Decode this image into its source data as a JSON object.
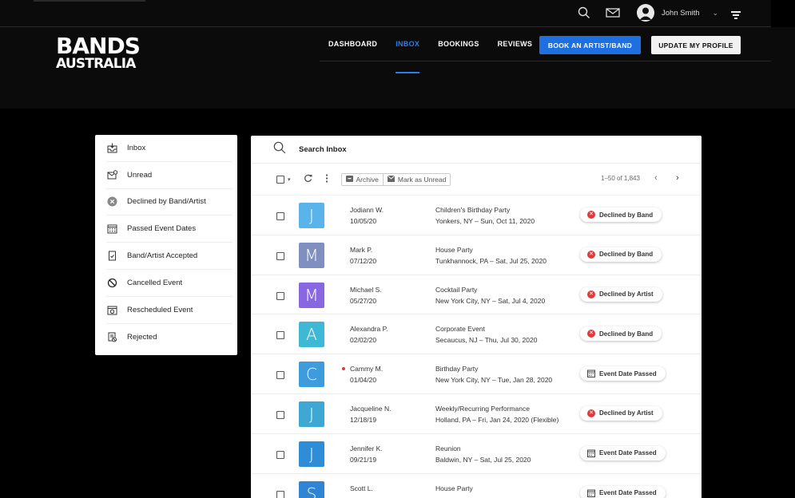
{
  "topbar": {
    "user_name": "John Smith",
    "icons": [
      "search-icon",
      "mail-icon",
      "user-avatar-icon",
      "chevron-down-icon",
      "menu-icon"
    ]
  },
  "header": {
    "logo_line1": "BANDS",
    "logo_line2": "AUSTRALIA",
    "nav": [
      {
        "label": "DASHBOARD",
        "active": false
      },
      {
        "label": "INBOX",
        "active": true
      },
      {
        "label": "BOOKINGS",
        "active": false
      },
      {
        "label": "REVIEWS",
        "active": false
      }
    ],
    "book_label": "BOOK AN ARTIST/BAND",
    "profile_label": "UPDATE MY PROFILE"
  },
  "sidebar": {
    "items": [
      {
        "label": "Inbox",
        "icon": "inbox-icon"
      },
      {
        "label": "Unread",
        "icon": "unread-mail-icon"
      },
      {
        "label": "Declined by Band/Artist",
        "icon": "declined-circle-icon"
      },
      {
        "label": "Passed Event Dates",
        "icon": "calendar-icon"
      },
      {
        "label": "Band/Artist Accepted",
        "icon": "accepted-document-icon"
      },
      {
        "label": "Cancelled Event",
        "icon": "cancelled-icon"
      },
      {
        "label": "Rescheduled Event",
        "icon": "rescheduled-calendar-icon"
      },
      {
        "label": "Rejected",
        "icon": "rejected-document-icon"
      }
    ]
  },
  "inbox": {
    "search_label": "Search Inbox",
    "archive_label": "Archive",
    "mark_unread_label": "Mark as Unread",
    "pager": "1–50 of 1,843",
    "rows": [
      {
        "initial": "J",
        "color": "#5ab4ea",
        "name": "Jodiann W.",
        "date": "10/05/20",
        "event": "Children's Birthday Party",
        "location": "Yonkers, NY – Sun, Oct 11, 2020",
        "status": "Declined by Band",
        "status_type": "declined",
        "unread": false
      },
      {
        "initial": "M",
        "color": "#7e8fc0",
        "name": "Mark P.",
        "date": "07/12/20",
        "event": "House Party",
        "location": "Tunkhannock, PA – Sat, Jul 25, 2020",
        "status": "Declined by Band",
        "status_type": "declined",
        "unread": false
      },
      {
        "initial": "M",
        "color": "#8867e0",
        "name": "Michael S.",
        "date": "05/27/20",
        "event": "Cocktail Party",
        "location": "New York City, NY – Sat, Jul 4, 2020",
        "status": "Declined by Artist",
        "status_type": "declined",
        "unread": false
      },
      {
        "initial": "A",
        "color": "#3fb8d6",
        "name": "Alexandra P.",
        "date": "02/02/20",
        "event": "Corporate Event",
        "location": "Secaucus, NJ – Thu, Jul 30, 2020",
        "status": "Declined by Band",
        "status_type": "declined",
        "unread": false
      },
      {
        "initial": "C",
        "color": "#3d9bde",
        "name": "Cammy M.",
        "date": "01/04/20",
        "event": "Birthday Party",
        "location": "New York City, NY – Tue, Jan 28, 2020",
        "status": "Event Date Passed",
        "status_type": "passed",
        "unread": true
      },
      {
        "initial": "J",
        "color": "#3ea7d3",
        "name": "Jacqueline N.",
        "date": "12/18/19",
        "event": "Weekly/Recurring Performance",
        "location": "Holland, PA – Fri, Jan 24, 2020 (Flexible)",
        "status": "Declined by Artist",
        "status_type": "declined",
        "unread": false
      },
      {
        "initial": "J",
        "color": "#2f8cd6",
        "name": "Jennifer K.",
        "date": "09/21/19",
        "event": "Reunion",
        "location": "Baldwin, NY – Sat, Jul 25, 2020",
        "status": "Event Date Passed",
        "status_type": "passed",
        "unread": false
      },
      {
        "initial": "S",
        "color": "#2f85d4",
        "name": "Scott L.",
        "date": "",
        "event": "House Party",
        "location": "",
        "status": "Event Date Passed",
        "status_type": "passed",
        "unread": false
      }
    ]
  }
}
